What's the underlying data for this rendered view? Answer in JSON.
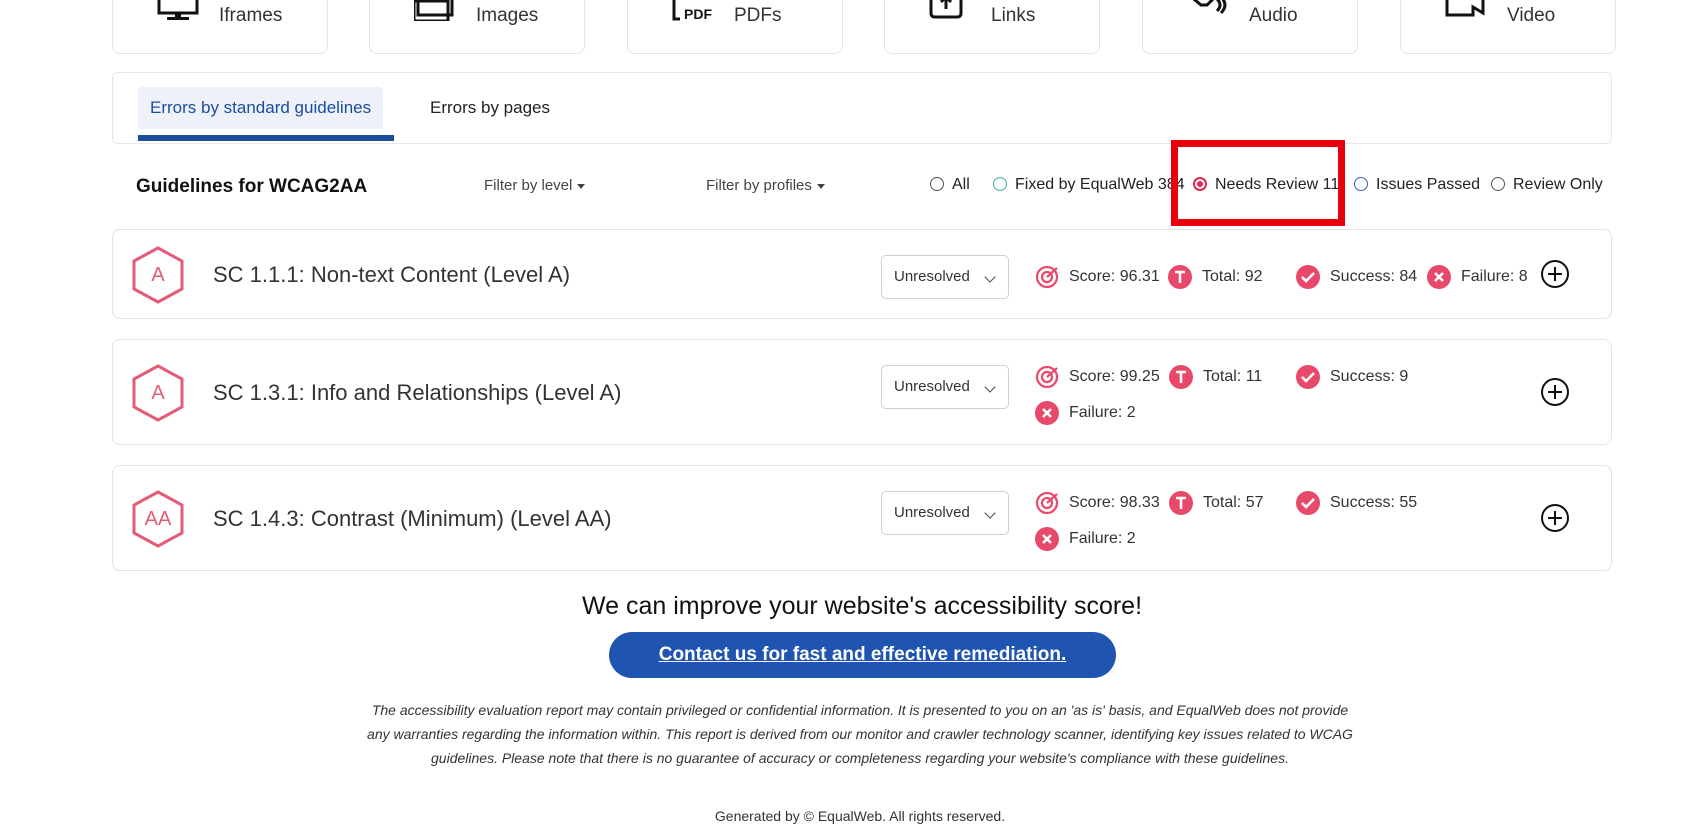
{
  "media_cards": [
    {
      "label": "Iframes",
      "icon": "monitor-icon"
    },
    {
      "label": "Images",
      "icon": "images-icon"
    },
    {
      "label": "PDFs",
      "icon": "pdf-icon"
    },
    {
      "label": "Links",
      "icon": "link-icon"
    },
    {
      "label": "Audio",
      "icon": "speaker-icon"
    },
    {
      "label": "Video",
      "icon": "video-icon"
    }
  ],
  "tabs": [
    {
      "label": "Errors by standard guidelines",
      "active": true
    },
    {
      "label": "Errors by pages",
      "active": false
    }
  ],
  "filters": {
    "title": "Guidelines for WCAG2AA",
    "level_label": "Filter by level",
    "profiles_label": "Filter by profiles",
    "options": [
      {
        "label": "All",
        "checked": false
      },
      {
        "label": "Fixed by EqualWeb 384",
        "checked": false
      },
      {
        "label": "Needs Review 11",
        "checked": true
      },
      {
        "label": "Issues Passed",
        "checked": false
      },
      {
        "label": "Review Only",
        "checked": false
      }
    ]
  },
  "guidelines": [
    {
      "level": "A",
      "title": "SC 1.1.1: Non-text Content (Level A)",
      "status": "Unresolved",
      "score": "Score: 96.31",
      "total": "Total: 92",
      "success": "Success: 84",
      "failure": "Failure: 8"
    },
    {
      "level": "A",
      "title": "SC 1.3.1: Info and Relationships (Level A)",
      "status": "Unresolved",
      "score": "Score: 99.25",
      "total": "Total: 11",
      "success": "Success: 9",
      "failure": "Failure: 2"
    },
    {
      "level": "AA",
      "title": "SC 1.4.3: Contrast (Minimum) (Level AA)",
      "status": "Unresolved",
      "score": "Score: 98.33",
      "total": "Total: 57",
      "success": "Success: 55",
      "failure": "Failure: 2"
    }
  ],
  "footer": {
    "improve": "We can improve your website's accessibility score!",
    "cta": "Contact us for fast and effective remediation.",
    "disclaimer": "The accessibility evaluation report may contain privileged or confidential information. It is presented to you on an 'as is' basis, and EqualWeb does not provide any warranties regarding the information within. This report is derived from our monitor and crawler technology scanner, identifying key issues related to WCAG guidelines. Please note that there is no guarantee of accuracy or completeness regarding your website's compliance with these guidelines.",
    "powered": "Generated by © EqualWeb. All rights reserved."
  },
  "colors": {
    "accent": "#1a4d9e",
    "stat_icon": "#e8496b",
    "highlight": "#e8000d",
    "cta_bg": "#1f54b0"
  }
}
